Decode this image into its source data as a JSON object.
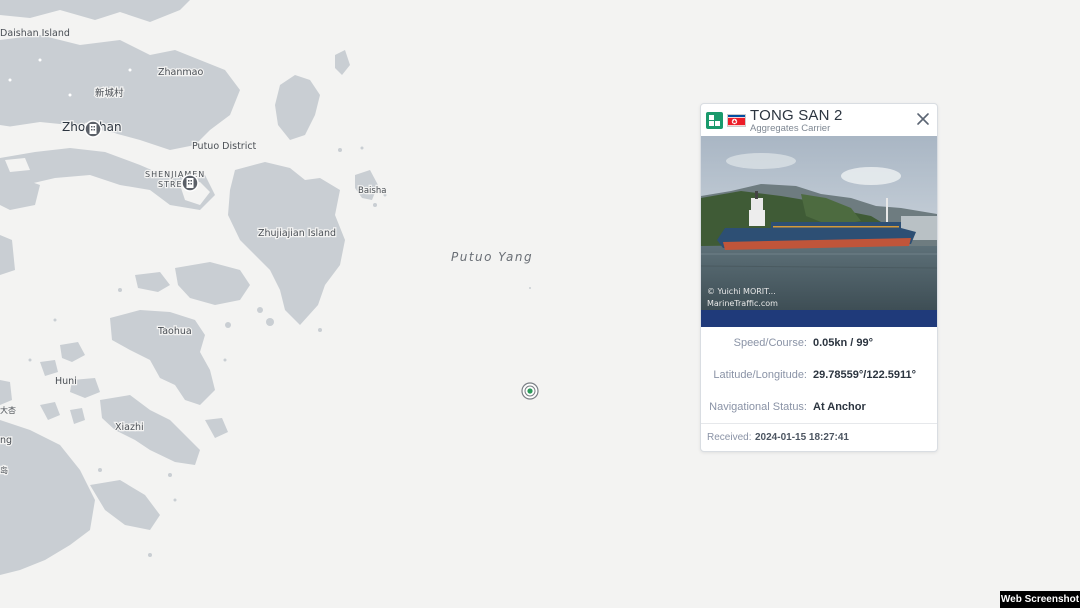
{
  "map": {
    "labels": {
      "daishan": "Daishan Island",
      "zhanmao": "Zhanmao",
      "xinchengcun": "新城村",
      "zhoushan": "Zhoushan",
      "putuo_district": "Putuo District",
      "shenjiamen_line1": "SHENJIAMEN",
      "shenjiamen_line2": "STREET",
      "baisha": "Baisha",
      "zhujiajian": "Zhujiajian Island",
      "taohua": "Taohua",
      "huni": "Huni",
      "xiazhi": "Xiazhi",
      "dazhe": "大杏",
      "dao": "岛",
      "ng": "ng"
    },
    "sea_label": "Putuo Yang",
    "colors": {
      "land": "#c9ced3",
      "water": "#f3f3f2",
      "vessel": "#2a9a5a"
    }
  },
  "popup": {
    "title": "TONG SAN 2",
    "subtitle": "Aggregates Carrier",
    "type_icon": "cargo-vessel-icon",
    "flag": "north-korea-flag-icon",
    "close_icon": "close-icon",
    "photo_credit_line1": "© Yuichi MORIT...",
    "photo_credit_line2": "MarineTraffic.com",
    "rows": [
      {
        "label": "Speed/Course:",
        "value": "0.05kn / 99°"
      },
      {
        "label": "Latitude/Longitude:",
        "value": "29.78559°/122.5911°"
      },
      {
        "label": "Navigational Status:",
        "value": "At Anchor"
      }
    ],
    "received_label": "Received:",
    "received_value": "2024-01-15 18:27:41"
  },
  "watermark": "Web Screenshot"
}
